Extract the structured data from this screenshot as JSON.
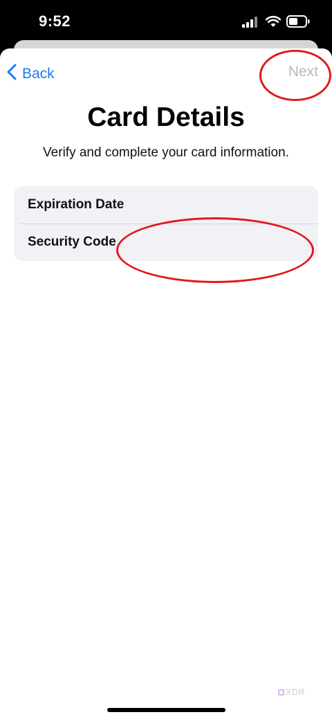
{
  "status_bar": {
    "time": "9:52",
    "icons": [
      "cellular-signal-icon",
      "wifi-icon",
      "battery-icon"
    ]
  },
  "nav": {
    "back_label": "Back",
    "next_label": "Next",
    "back_icon": "chevron-left-icon"
  },
  "page": {
    "title": "Card Details",
    "subtitle": "Verify and complete your card information."
  },
  "form": {
    "rows": [
      {
        "label": "Expiration Date"
      },
      {
        "label": "Security Code"
      }
    ]
  },
  "watermark": "XDR",
  "colors": {
    "accent": "#1a7cf3",
    "disabled": "#b9b9bd",
    "highlight": "#e0191f",
    "group_background": "#f2f1f6"
  }
}
